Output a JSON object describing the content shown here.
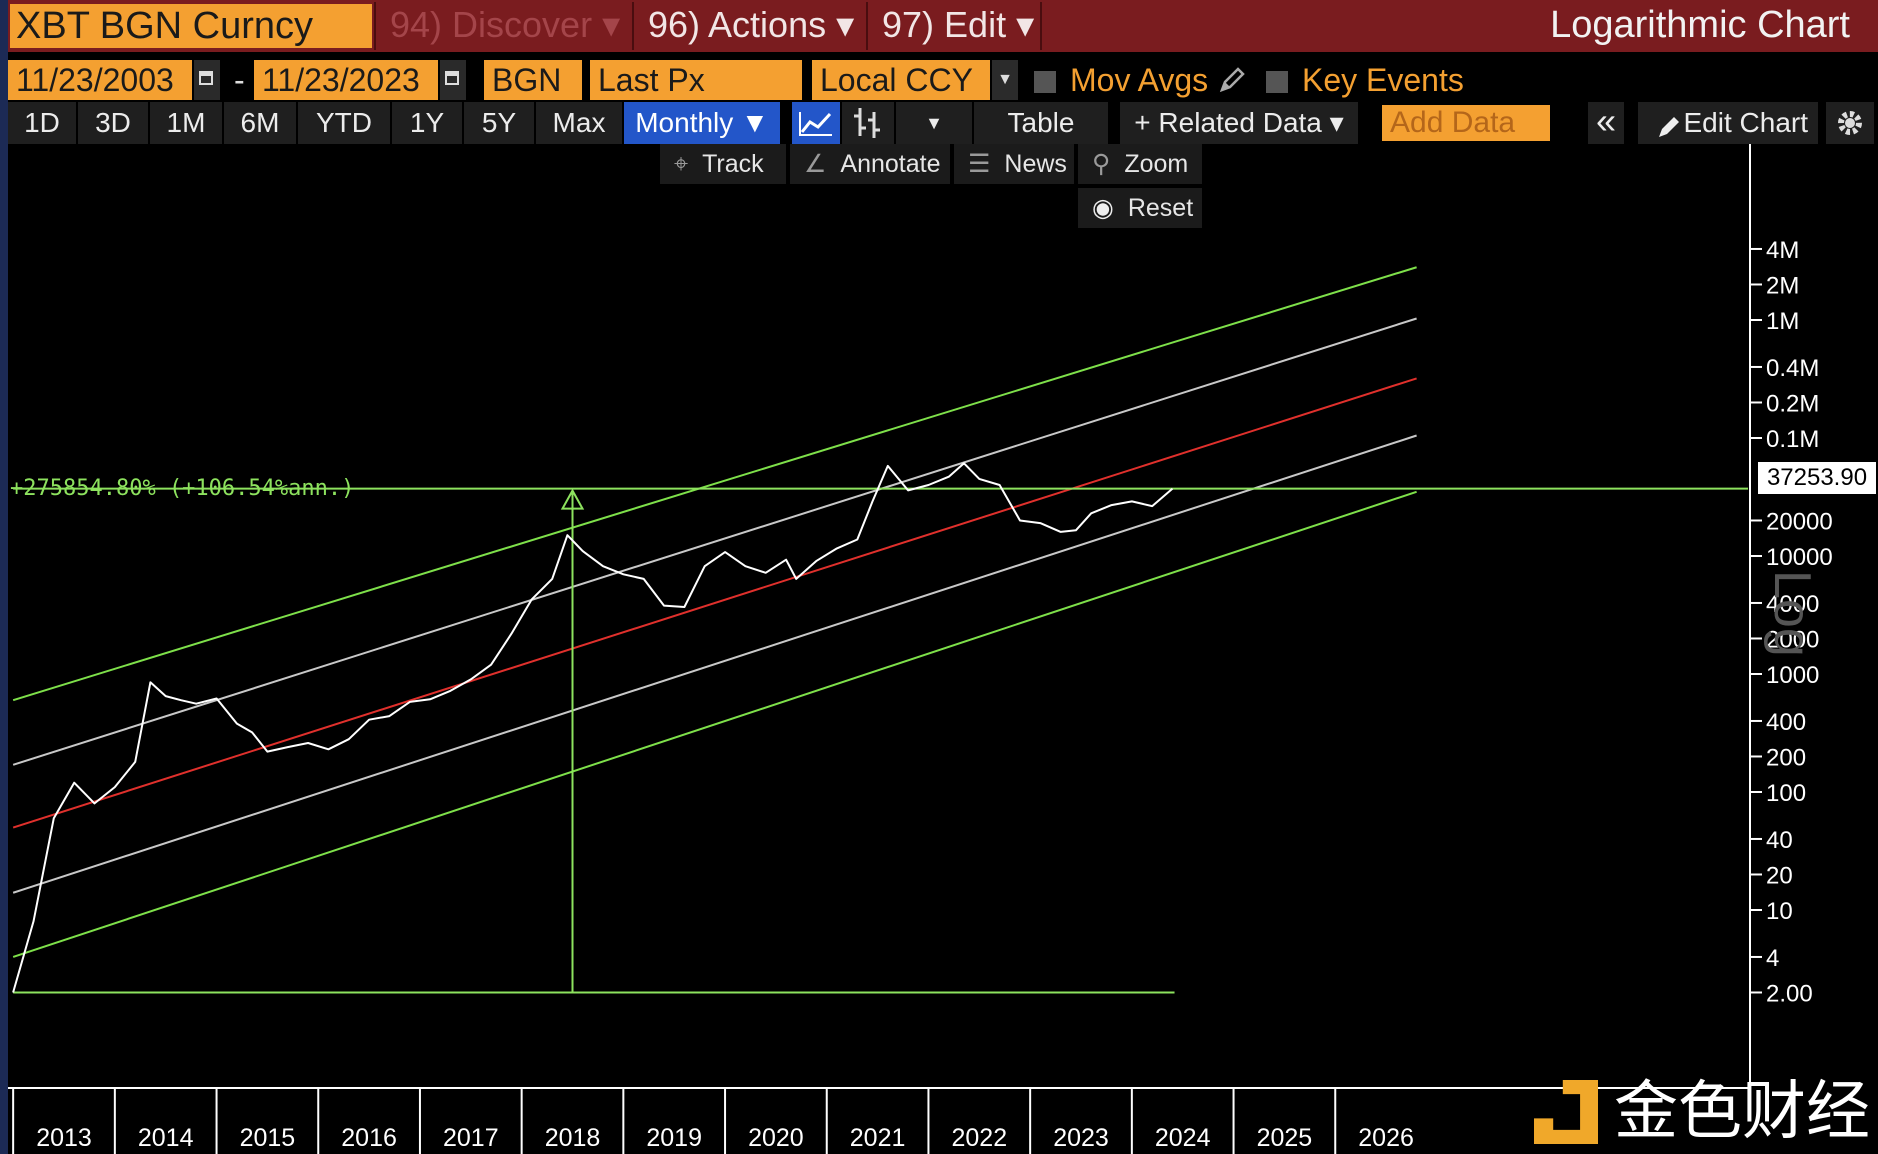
{
  "title_bar": {
    "ticker": "XBT BGN Curncy",
    "menus": [
      {
        "label": "94) Discover ▾"
      },
      {
        "label": "96) Actions ▾"
      },
      {
        "label": "97) Edit ▾"
      }
    ],
    "chart_title": "Logarithmic Chart"
  },
  "options_bar": {
    "start_date": "11/23/2003",
    "date_separator": "-",
    "end_date": "11/23/2023",
    "source": "BGN",
    "field": "Last Px",
    "currency": "Local CCY",
    "mov_avgs": "Mov Avgs",
    "key_events": "Key Events"
  },
  "range_bar": {
    "ranges": [
      "1D",
      "3D",
      "1M",
      "6M",
      "YTD",
      "1Y",
      "5Y",
      "Max"
    ],
    "period": "Monthly ▼",
    "table": "Table",
    "related_data": "+ Related Data ▾",
    "add_data_placeholder": "Add Data",
    "collapse": "«",
    "edit_chart": "Edit Chart"
  },
  "chart_tools": {
    "track": "Track",
    "annotate": "Annotate",
    "news": "News",
    "zoom": "Zoom",
    "reset": "Reset"
  },
  "annotation_text": "+275854.80% (+106.54%ann.)",
  "last_price_label": "37253.90",
  "scale_label": "Log",
  "watermark_text": "金色财经",
  "colors": {
    "title_bg": "#7a1c1f",
    "orange_field": "#f4a031",
    "price_line": "#ffffff",
    "channel_outer": "#7ee04a",
    "channel_inner": "#c8c8c8",
    "channel_mid": "#e0302c",
    "annotation": "#8de25e"
  },
  "chart_data": {
    "type": "line",
    "title": "Logarithmic Chart",
    "yscale": "log",
    "ylim": [
      1.5,
      6000000
    ],
    "xlim": [
      2012.5,
      2026.5
    ],
    "y_tick_labels": [
      "4M",
      "2M",
      "1M",
      "0.4M",
      "0.2M",
      "0.1M",
      "20000",
      "10000",
      "4000",
      "2000",
      "1000",
      "400",
      "200",
      "100",
      "40",
      "20",
      "10",
      "4",
      "2.00"
    ],
    "y_tick_values": [
      4000000,
      2000000,
      1000000,
      400000,
      200000,
      100000,
      20000,
      10000,
      4000,
      2000,
      1000,
      400,
      200,
      100,
      40,
      20,
      10,
      4,
      2
    ],
    "x_tick_labels": [
      "2013",
      "2014",
      "2015",
      "2016",
      "2017",
      "2018",
      "2019",
      "2020",
      "2021",
      "2022",
      "2023",
      "2024",
      "2025",
      "2026"
    ],
    "series": [
      {
        "x": [
          2012.5,
          2012.7,
          2012.9,
          2013.1,
          2013.3,
          2013.5,
          2013.7,
          2013.85,
          2014.0,
          2014.15,
          2014.3,
          2014.5,
          2014.7,
          2014.85,
          2015.0,
          2015.2,
          2015.4,
          2015.6,
          2015.8,
          2016.0,
          2016.2,
          2016.4,
          2016.6,
          2016.8,
          2017.0,
          2017.2,
          2017.4,
          2017.6,
          2017.8,
          2017.95,
          2018.1,
          2018.3,
          2018.5,
          2018.7,
          2018.9,
          2019.1,
          2019.3,
          2019.5,
          2019.7,
          2019.9,
          2020.1,
          2020.2,
          2020.4,
          2020.6,
          2020.8,
          2020.95,
          2021.1,
          2021.3,
          2021.5,
          2021.7,
          2021.85,
          2022.0,
          2022.2,
          2022.4,
          2022.6,
          2022.8,
          2022.95,
          2023.1,
          2023.3,
          2023.5,
          2023.7,
          2023.9
        ],
        "y": [
          2,
          8,
          60,
          120,
          80,
          110,
          180,
          850,
          650,
          600,
          560,
          620,
          380,
          320,
          220,
          240,
          260,
          230,
          280,
          410,
          440,
          580,
          610,
          720,
          900,
          1200,
          2200,
          4300,
          6400,
          15000,
          11000,
          8200,
          7000,
          6400,
          3800,
          3700,
          8200,
          10800,
          8200,
          7200,
          9300,
          6400,
          9100,
          11600,
          13800,
          29000,
          58000,
          36000,
          40000,
          47000,
          61000,
          45000,
          40000,
          20000,
          19000,
          16000,
          16500,
          23000,
          27000,
          29000,
          26500,
          37253.9
        ],
        "unit": "USD"
      }
    ],
    "channels": [
      {
        "name": "upper",
        "start": [
          2012.5,
          600
        ],
        "end": [
          2026.3,
          2800000
        ]
      },
      {
        "name": "upper-inner",
        "start": [
          2012.5,
          170
        ],
        "end": [
          2026.3,
          1030000
        ]
      },
      {
        "name": "middle",
        "start": [
          2012.5,
          50
        ],
        "end": [
          2026.3,
          320000
        ]
      },
      {
        "name": "lower-inner",
        "start": [
          2012.5,
          14
        ],
        "end": [
          2026.3,
          105000
        ]
      },
      {
        "name": "lower",
        "start": [
          2012.5,
          4
        ],
        "end": [
          2026.3,
          35000
        ]
      }
    ],
    "measure": {
      "from": [
        2012.5,
        2
      ],
      "to": [
        2023.9,
        37253.9
      ],
      "annotation": "+275854.80% (+106.54%ann.)"
    }
  }
}
